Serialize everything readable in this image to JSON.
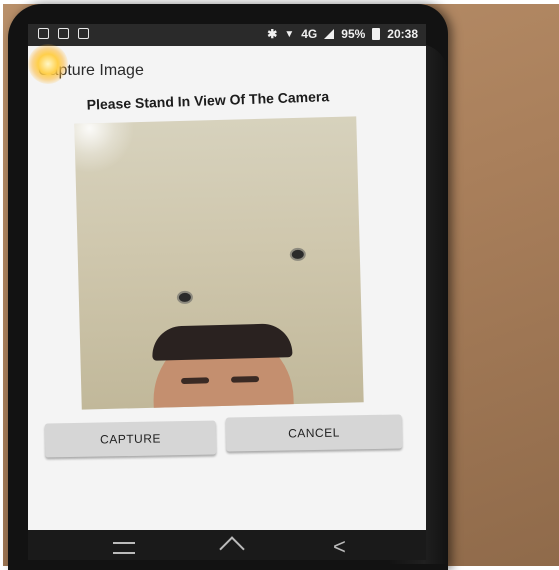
{
  "status_bar": {
    "network": "4G",
    "battery": "95%",
    "time": "20:38",
    "icons": [
      "image-icon",
      "lock-icon",
      "screenshot-icon",
      "bluetooth-icon",
      "wifi-icon",
      "signal-icon",
      "battery-icon"
    ]
  },
  "app": {
    "title": "Capture Image",
    "instruction": "Please Stand In View Of The Camera"
  },
  "buttons": {
    "capture": "CAPTURE",
    "cancel": "CANCEL"
  },
  "nav": {
    "icons": [
      "menu-icon",
      "home-icon",
      "back-icon"
    ]
  }
}
